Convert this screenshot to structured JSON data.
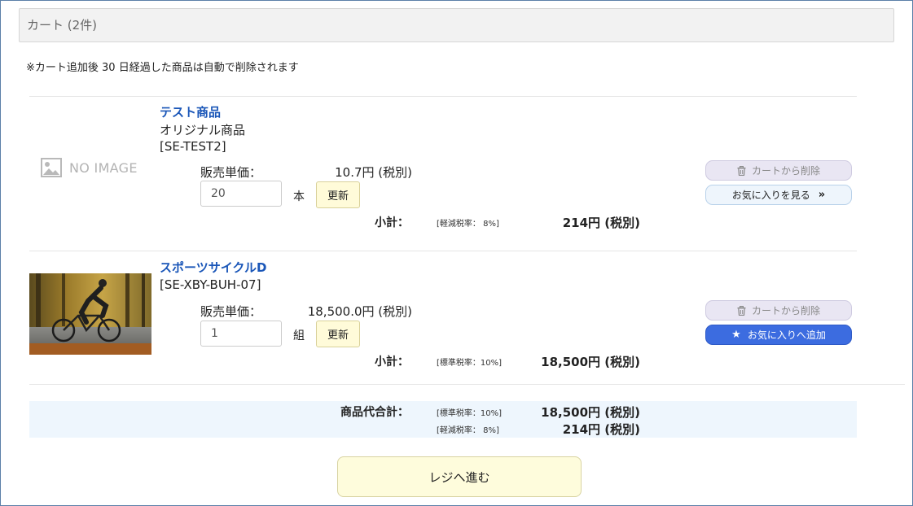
{
  "cart": {
    "title": "カート (2件)",
    "notice": "※カート追加後 30 日経過した商品は自動で削除されます"
  },
  "items": [
    {
      "name": "テスト商品",
      "subtitle": "オリジナル商品",
      "sku": "[SE-TEST2]",
      "image_label": "NO IMAGE",
      "unit_price_label": "販売単価：",
      "unit_price": "10.7円 (税別)",
      "quantity": "20",
      "unit": "本",
      "update_label": "更新",
      "subtotal_label": "小計：",
      "tax_rate": "[軽減税率： 8%]",
      "subtotal": "214円 (税別)",
      "remove_label": "カートから削除",
      "favorite_label": "お気に入りを見る",
      "favorite_icon": "chevron-double-right-icon"
    },
    {
      "name": "スポーツサイクルD",
      "sku": "[SE-XBY-BUH-07]",
      "image_alt": "cyclist-photo",
      "unit_price_label": "販売単価：",
      "unit_price": "18,500.0円 (税別)",
      "quantity": "1",
      "unit": "組",
      "update_label": "更新",
      "subtotal_label": "小計：",
      "tax_rate": "[標準税率：10%]",
      "subtotal": "18,500円 (税別)",
      "remove_label": "カートから削除",
      "favorite_label": "お気に入りへ追加",
      "favorite_icon": "star-icon"
    }
  ],
  "totals": {
    "label": "商品代合計：",
    "standard_rate": "[標準税率：10%]",
    "standard_amount": "18,500円 (税別)",
    "reduced_rate": "[軽減税率： 8%]",
    "reduced_amount": "214円 (税別)"
  },
  "checkout": {
    "label": "レジへ進む"
  },
  "colors": {
    "link": "#1a56b8",
    "favorite_add_bg": "#3c6ce0",
    "update_bg": "#fffbd9",
    "checkout_bg": "#fefcdc",
    "total_bg": "#eef6fd"
  }
}
